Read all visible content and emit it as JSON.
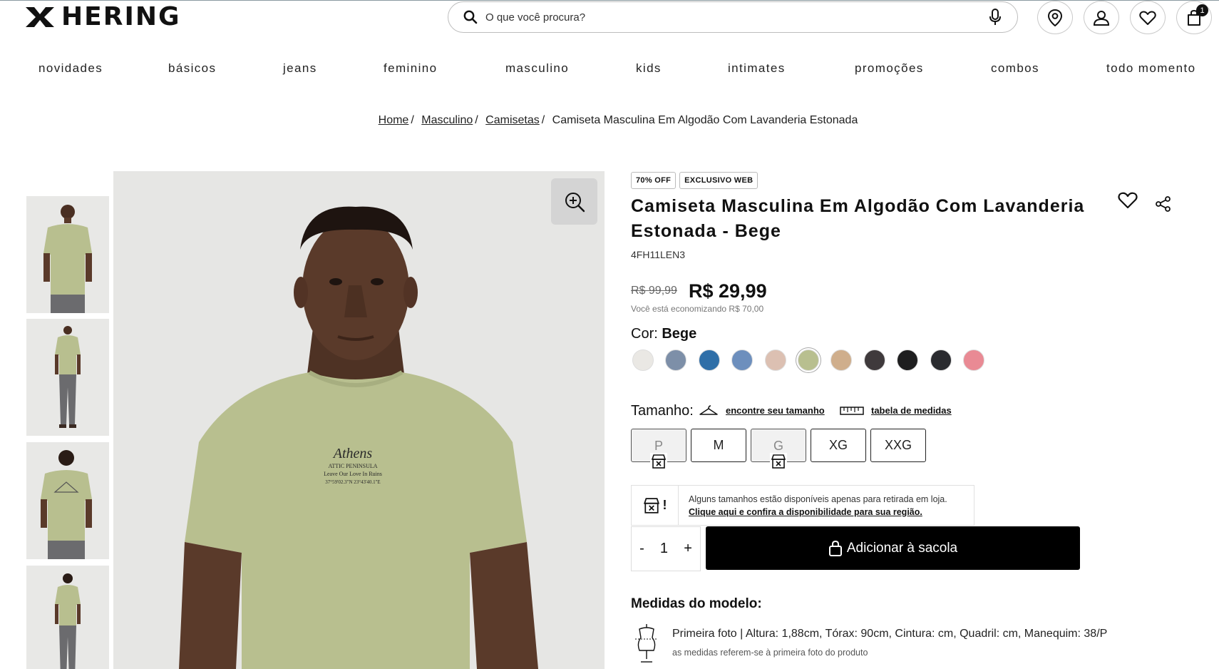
{
  "header": {
    "brand": "HERING",
    "search_placeholder": "O que você procura?",
    "cart_count": "1"
  },
  "nav": [
    "novidades",
    "básicos",
    "jeans",
    "feminino",
    "masculino",
    "kids",
    "intimates",
    "promoções",
    "combos",
    "todo momento"
  ],
  "breadcrumb": {
    "items": [
      "Home",
      "Masculino",
      "Camisetas"
    ],
    "current": "Camiseta Masculina Em Algodão Com Lavanderia Estonada"
  },
  "product": {
    "badges": [
      "70% OFF",
      "EXCLUSIVO WEB"
    ],
    "title": "Camiseta Masculina Em Algodão Com Lavanderia Estonada - Bege",
    "sku": "4FH11LEN3",
    "old_price": "R$ 99,99",
    "price": "R$ 29,99",
    "saving": "Você está economizando R$ 70,00",
    "color_label": "Cor:",
    "color_value": "Bege",
    "swatches": [
      "#eae8e4",
      "#7d8fa8",
      "#2f6fa8",
      "#6d8fbd",
      "#dcc0b2",
      "#b8bf8f",
      "#cfae8c",
      "#3f3a3c",
      "#1e1e1f",
      "#2a2b2f",
      "#e98a94"
    ],
    "selected_swatch": 5,
    "size_label": "Tamanho:",
    "find_size": "encontre seu tamanho",
    "size_table": "tabela de medidas",
    "sizes": [
      {
        "label": "P",
        "store_only": true
      },
      {
        "label": "M",
        "store_only": false
      },
      {
        "label": "G",
        "store_only": true
      },
      {
        "label": "XG",
        "store_only": false
      },
      {
        "label": "XXG",
        "store_only": false
      }
    ],
    "notice_line1": "Alguns tamanhos estão disponíveis apenas para retirada em loja.",
    "notice_line2": "Clique aqui e confira a disponibilidade para sua região.",
    "notice_icon_mark": "!",
    "qty_minus": "-",
    "qty": "1",
    "qty_plus": "+",
    "add_to_bag": "Adicionar à sacola",
    "model_title": "Medidas do modelo:",
    "model_line": "Primeira foto | Altura: 1,88cm, Tórax: 90cm, Cintura: cm, Quadril: cm, Manequim: 38/P",
    "model_sub": "as medidas referem-se à primeira foto do produto"
  },
  "gallery": {
    "shirt_print_title": "Athens",
    "shirt_print_line1": "ATTIC PENINSULA",
    "shirt_print_line2": "Leave Our Love In Ruins",
    "shirt_print_line3": "37°59'02.3\"N 23°43'40.1\"E"
  },
  "colors": {
    "shirt": "#b8bf8f",
    "skin": "#5a3a2a",
    "background": "#e6e6e4",
    "button": "#000000"
  }
}
